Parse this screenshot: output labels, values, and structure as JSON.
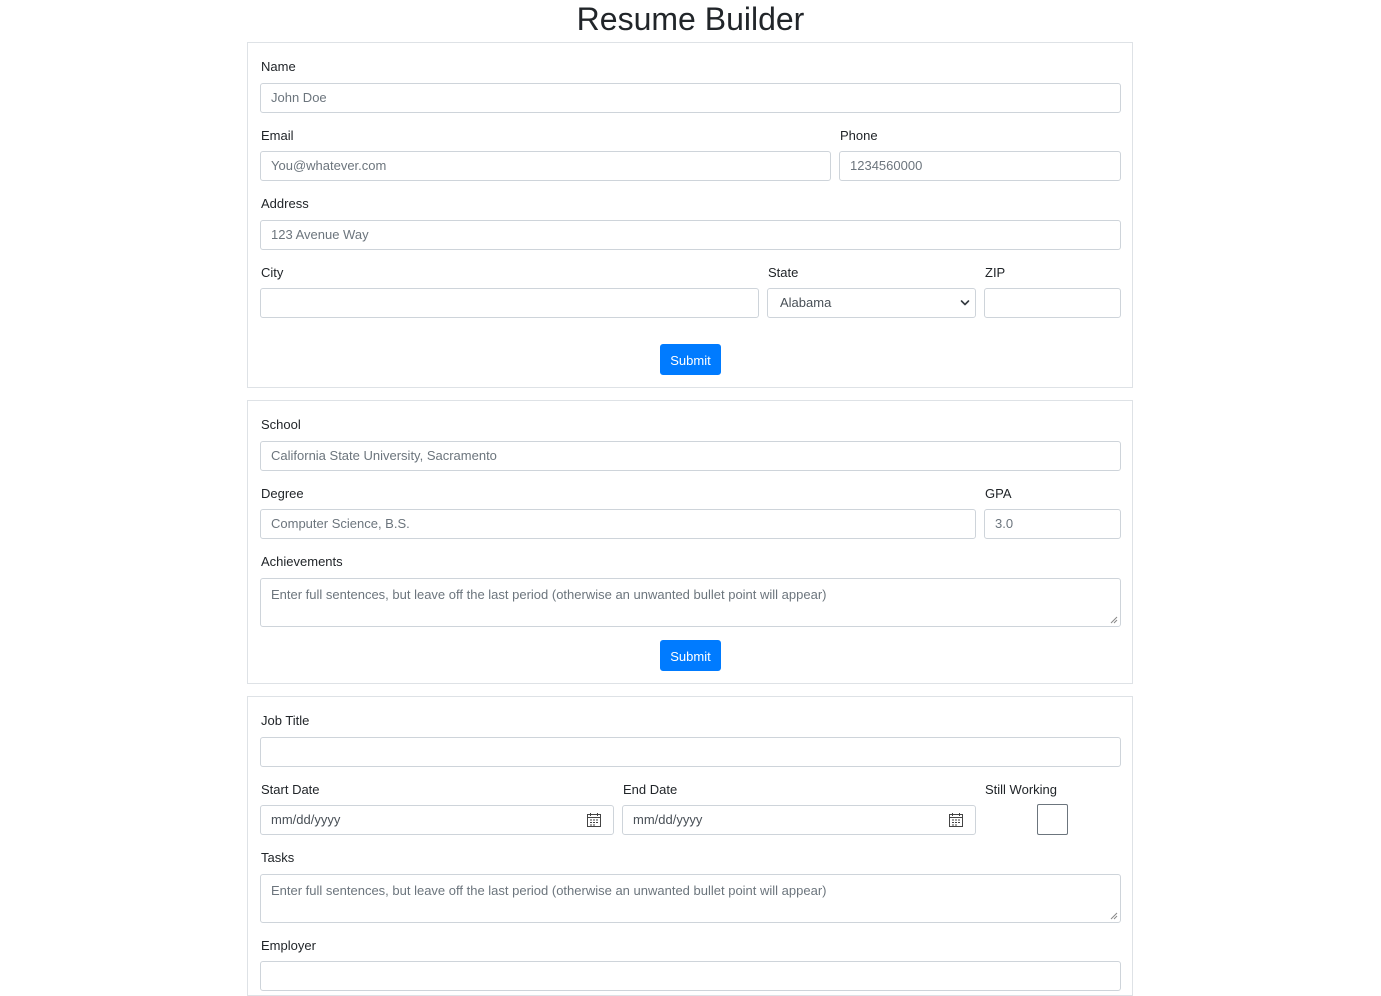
{
  "title": "Resume Builder",
  "contact": {
    "name_label": "Name",
    "name_placeholder": "John Doe",
    "email_label": "Email",
    "email_placeholder": "You@whatever.com",
    "phone_label": "Phone",
    "phone_placeholder": "1234560000",
    "address_label": "Address",
    "address_placeholder": "123 Avenue Way",
    "city_label": "City",
    "city_value": "",
    "state_label": "State",
    "state_value": "Alabama",
    "zip_label": "ZIP",
    "zip_value": "",
    "submit_label": "Submit"
  },
  "education": {
    "school_label": "School",
    "school_placeholder": "California State University, Sacramento",
    "degree_label": "Degree",
    "degree_placeholder": "Computer Science, B.S.",
    "gpa_label": "GPA",
    "gpa_placeholder": "3.0",
    "achievements_label": "Achievements",
    "achievements_placeholder": "Enter full sentences, but leave off the last period (otherwise an unwanted bullet point will appear)",
    "submit_label": "Submit"
  },
  "experience": {
    "job_title_label": "Job Title",
    "job_title_value": "",
    "start_date_label": "Start Date",
    "start_date_placeholder": "mm/dd/yyyy",
    "end_date_label": "End Date",
    "end_date_placeholder": "mm/dd/yyyy",
    "still_working_label": "Still Working",
    "still_working_checked": false,
    "tasks_label": "Tasks",
    "tasks_placeholder": "Enter full sentences, but leave off the last period (otherwise an unwanted bullet point will appear)",
    "employer_label": "Employer"
  },
  "icons": {
    "select_caret": "chevron-down-icon",
    "date_picker": "calendar-icon",
    "textarea_resize": "resize-handle-icon"
  },
  "colors": {
    "primary": "#007bff",
    "border": "#dee2e6",
    "input_border": "#ced4da",
    "placeholder": "#6c757d",
    "text": "#212529"
  }
}
